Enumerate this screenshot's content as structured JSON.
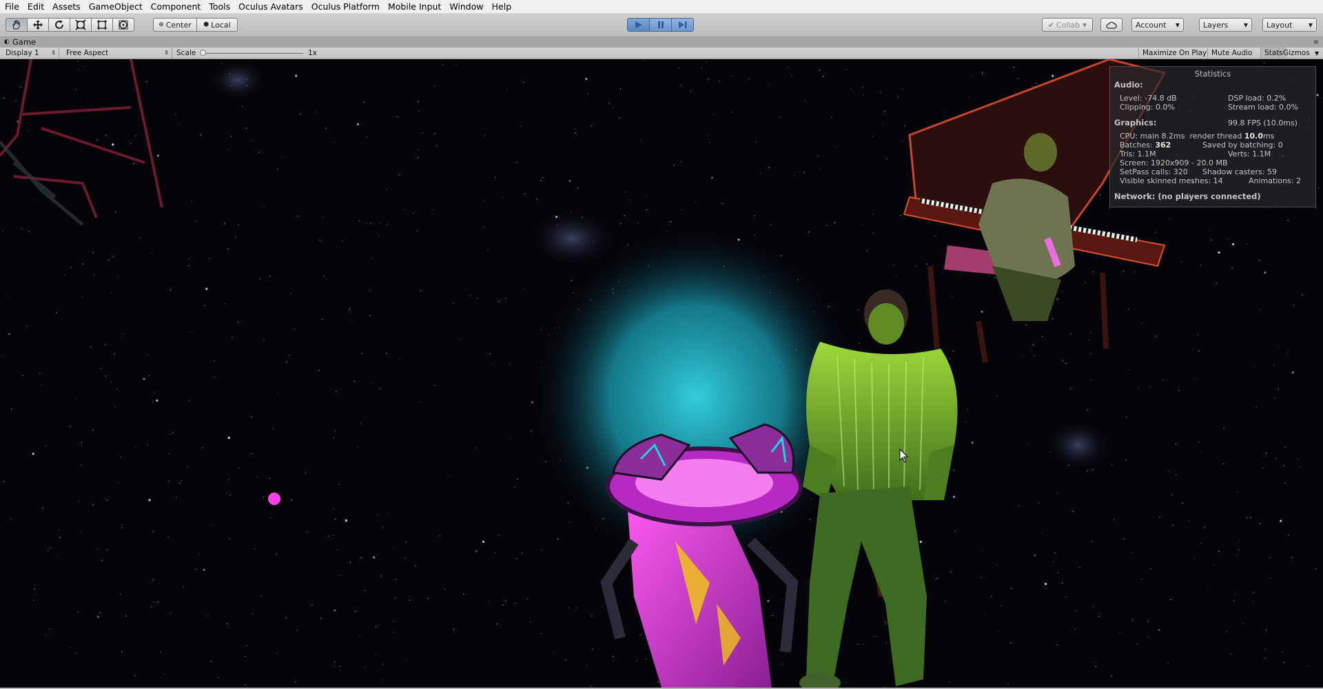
{
  "menu": [
    "File",
    "Edit",
    "Assets",
    "GameObject",
    "Component",
    "Tools",
    "Oculus Avatars",
    "Oculus Platform",
    "Mobile Input",
    "Window",
    "Help"
  ],
  "toolbar": {
    "tools": [
      {
        "name": "hand-tool-icon"
      },
      {
        "name": "move-tool-icon"
      },
      {
        "name": "rotate-tool-icon"
      },
      {
        "name": "scale-tool-icon"
      },
      {
        "name": "rect-tool-icon"
      },
      {
        "name": "transform-tool-icon"
      }
    ],
    "pivot_center": "Center",
    "pivot_local": "Local",
    "collab": "Collab",
    "account": "Account",
    "layers": "Layers",
    "layout": "Layout"
  },
  "game_tab": {
    "label": "Game"
  },
  "game_bar": {
    "display": "Display 1",
    "aspect": "Free Aspect",
    "scale_label": "Scale",
    "scale_value": "1x",
    "maximize": "Maximize On Play",
    "mute": "Mute Audio",
    "stats": "Stats",
    "gizmos": "Gizmos"
  },
  "stats": {
    "title": "Statistics",
    "audio_heading": "Audio:",
    "level": "Level: -74.8 dB",
    "dsp": "DSP load: 0.2%",
    "clipping": "Clipping: 0.0%",
    "stream": "Stream load: 0.0%",
    "graphics_heading": "Graphics:",
    "fps": "99.8 FPS (10.0ms)",
    "cpu_prefix": "CPU: main 8.2ms  render thread ",
    "cpu_render": "10.0",
    "cpu_suffix": "ms",
    "batches_prefix": "Batches: ",
    "batches_value": "362",
    "saved": "Saved by batching: 0",
    "tris": "Tris: 1.1M",
    "verts": "Verts: 1.1M",
    "screen": "Screen: 1920x909 - 20.0 MB",
    "setpass": "SetPass calls: 320",
    "shadow": "Shadow casters: 59",
    "skinned": "Visible skinned meshes: 14",
    "animations": "Animations: 2",
    "network": "Network: (no players connected)"
  },
  "colors": {
    "play_active": "#5b88c2",
    "glow_cyan": "#29c7d6",
    "magenta": "#e23ee6",
    "green_figure": "#7bbf2c"
  }
}
